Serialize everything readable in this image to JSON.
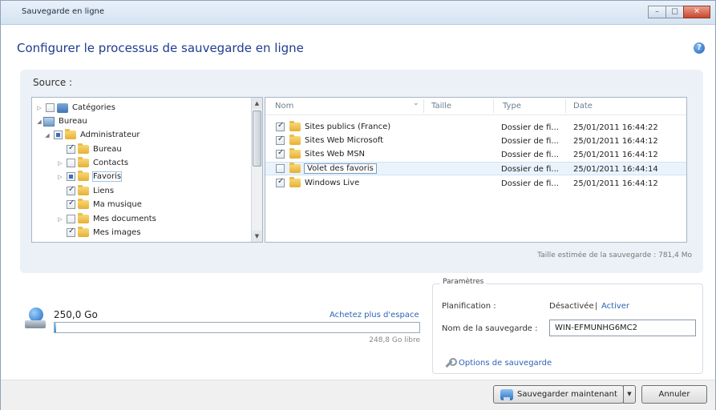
{
  "window": {
    "title": "Sauvegarde en ligne",
    "controls": {
      "minimize": "–",
      "maximize": "□",
      "close": "✕"
    }
  },
  "heading": "Configurer le processus de sauvegarde en ligne",
  "help_icon": "?",
  "source": {
    "label": "Source :",
    "tree": [
      {
        "label": "Catégories",
        "indent": 0,
        "arrow": "▷",
        "check": "none",
        "icon": "categories-icon"
      },
      {
        "label": "Bureau",
        "indent": 0,
        "arrow": "◢",
        "check": null,
        "icon": "desktop-icon"
      },
      {
        "label": "Administrateur",
        "indent": 1,
        "arrow": "◢",
        "check": "partial",
        "icon": "folder-icon"
      },
      {
        "label": "Bureau",
        "indent": 2,
        "arrow": "",
        "check": "checked",
        "icon": "folder-icon"
      },
      {
        "label": "Contacts",
        "indent": 2,
        "arrow": "▷",
        "check": "none",
        "icon": "folder-icon"
      },
      {
        "label": "Favoris",
        "indent": 2,
        "arrow": "▷",
        "check": "partial",
        "icon": "folder-icon",
        "selected": true
      },
      {
        "label": "Liens",
        "indent": 2,
        "arrow": "",
        "check": "checked",
        "icon": "folder-icon"
      },
      {
        "label": "Ma musique",
        "indent": 2,
        "arrow": "",
        "check": "checked",
        "icon": "folder-icon"
      },
      {
        "label": "Mes documents",
        "indent": 2,
        "arrow": "▷",
        "check": "none",
        "icon": "folder-icon"
      },
      {
        "label": "Mes images",
        "indent": 2,
        "arrow": "",
        "check": "checked",
        "icon": "folder-icon"
      }
    ],
    "scroll_up": "▲",
    "scroll_down": "▼"
  },
  "filelist": {
    "columns": {
      "name": "Nom",
      "size": "Taille",
      "type": "Type",
      "date": "Date",
      "sort_indicator": "⌄"
    },
    "rows": [
      {
        "name": "Sites publics (France)",
        "size": "",
        "type": "Dossier de fi...",
        "date": "25/01/2011 16:44:22",
        "checked": true
      },
      {
        "name": "Sites Web Microsoft",
        "size": "",
        "type": "Dossier de fi...",
        "date": "25/01/2011 16:44:12",
        "checked": true
      },
      {
        "name": "Sites Web MSN",
        "size": "",
        "type": "Dossier de fi...",
        "date": "25/01/2011 16:44:12",
        "checked": true
      },
      {
        "name": "Volet des favoris",
        "size": "",
        "type": "Dossier de fi...",
        "date": "25/01/2011 16:44:14",
        "checked": false,
        "selected": true
      },
      {
        "name": "Windows Live",
        "size": "",
        "type": "Dossier de fi...",
        "date": "25/01/2011 16:44:12",
        "checked": true
      }
    ]
  },
  "estimate": "Taille estimée de la sauvegarde : 781,4 Mo",
  "storage": {
    "total": "250,0 Go",
    "buy_link": "Achetez plus d'espace",
    "free": "248,8 Go libre",
    "used_fraction": 0.005
  },
  "params": {
    "title": "Paramètres",
    "schedule_label": "Planification :",
    "schedule_value": "Désactivée",
    "separator": "|",
    "activate_link": "Activer",
    "name_label": "Nom de la sauvegarde :",
    "name_value": "WIN-EFMUNHG6MC2",
    "options_link": "Options de sauvegarde"
  },
  "footer": {
    "backup_now": "Sauvegarder maintenant",
    "split_arrow": "▼",
    "cancel": "Annuler"
  }
}
